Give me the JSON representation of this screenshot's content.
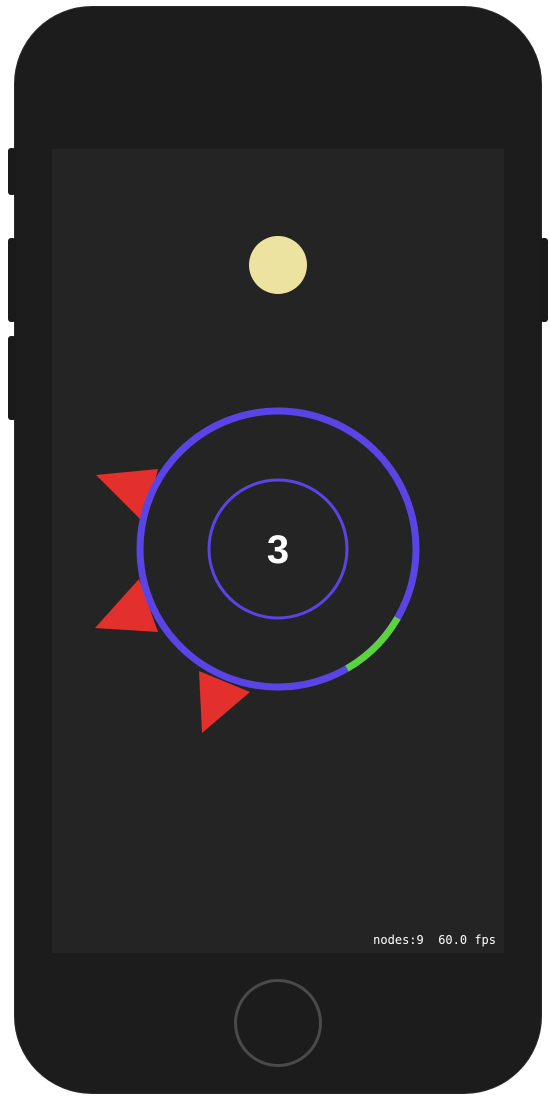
{
  "game": {
    "score": "3",
    "debug": {
      "nodes": "nodes:9",
      "fps": "60.0 fps"
    },
    "colors": {
      "background": "#242424",
      "ring": "#5b44e6",
      "safe_arc": "#5ad33f",
      "spike": "#e3302c",
      "ball": "#ede3a0"
    }
  },
  "device": {
    "model": "iPhone",
    "home_button_icon": "home-button-circle"
  }
}
